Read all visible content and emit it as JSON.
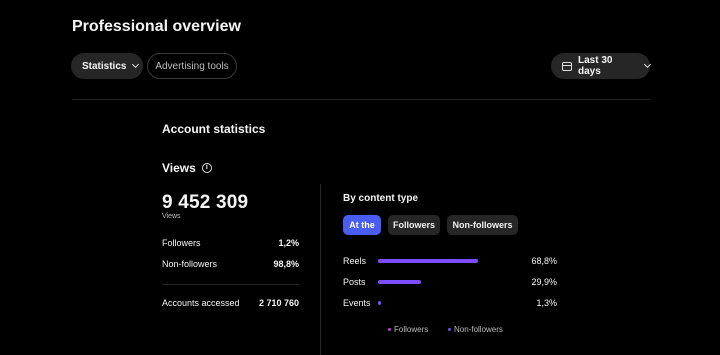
{
  "header": {
    "title": "Professional overview"
  },
  "toolbar": {
    "statistics_label": "Statistics",
    "advertising_label": "Advertising tools",
    "range_label": "Last 30 days"
  },
  "account": {
    "heading": "Account statistics"
  },
  "views": {
    "heading": "Views",
    "total": "9 452 309",
    "total_caption": "Views",
    "rows": [
      {
        "label": "Followers",
        "value": "1,2%"
      },
      {
        "label": "Non-followers",
        "value": "98,8%"
      }
    ],
    "accounts_accessed": {
      "label": "Accounts accessed",
      "value": "2 710 760"
    }
  },
  "content": {
    "heading": "By content type",
    "tabs": [
      {
        "label": "At the",
        "active": true
      },
      {
        "label": "Followers",
        "active": false
      },
      {
        "label": "Non-followers",
        "active": false
      }
    ],
    "bars": [
      {
        "label": "Reels",
        "value": "68,8%",
        "fraction": 0.688
      },
      {
        "label": "Posts",
        "value": "29,9%",
        "fraction": 0.299
      },
      {
        "label": "Events",
        "value": "1,3%",
        "fraction": 0.013
      }
    ],
    "legend": [
      {
        "label": "Followers",
        "color": "#c13bd6"
      },
      {
        "label": "Non-followers",
        "color": "#6a4dff"
      }
    ]
  },
  "colors": {
    "accent": "#4a5df2",
    "bar": "#7b4dff",
    "background": "#000000"
  }
}
